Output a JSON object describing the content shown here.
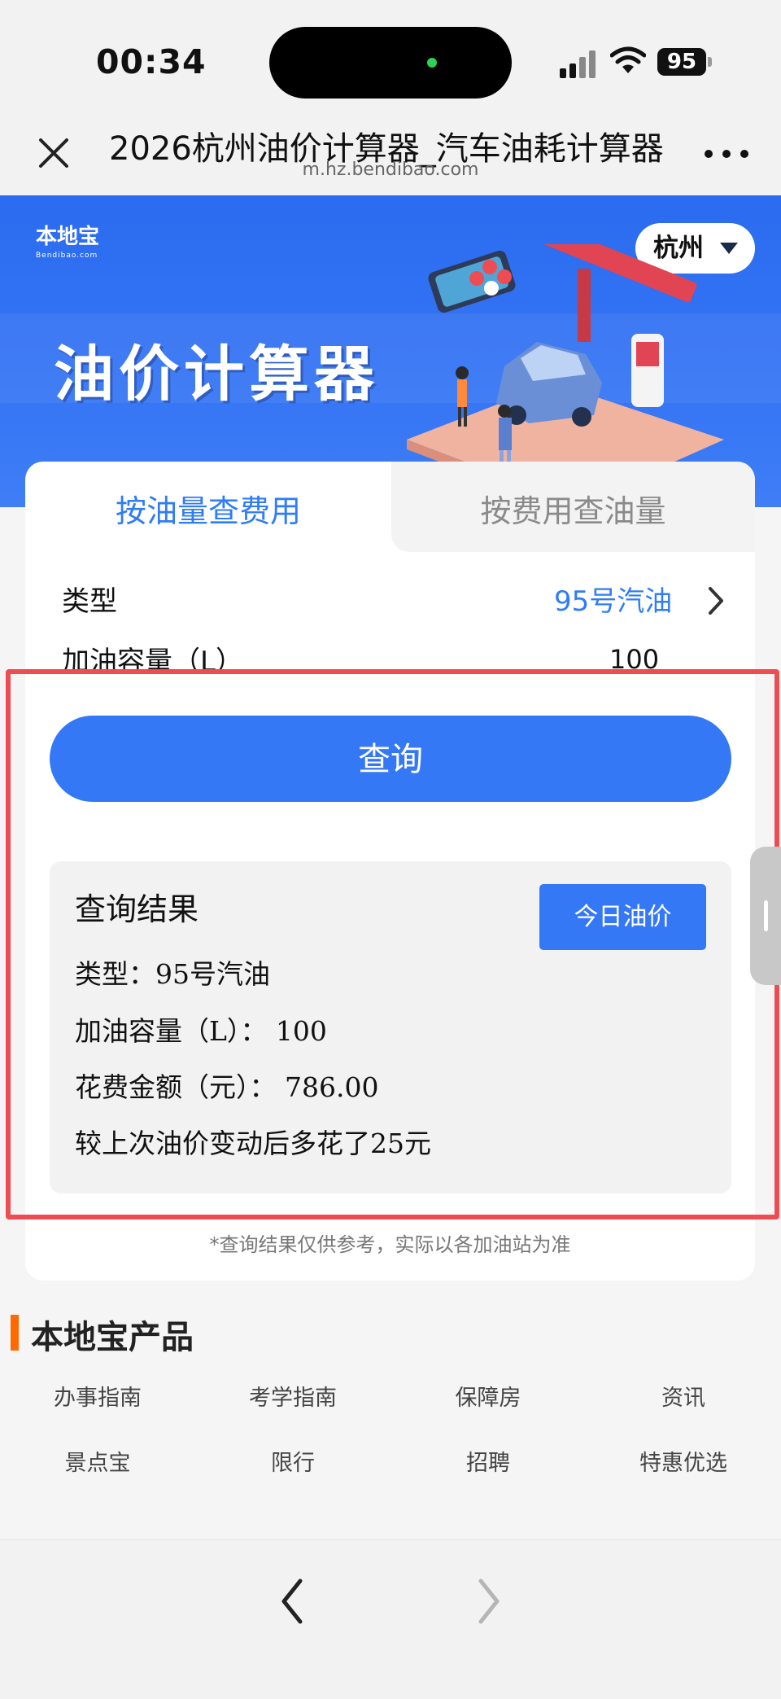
{
  "status_bar": {
    "time": "00:34",
    "battery": "95"
  },
  "browser": {
    "title": "2026杭州油价计算器_汽车油耗计算器",
    "url": "m.hz.bendibao.com",
    "icons": [
      "close-icon",
      "more-icon"
    ]
  },
  "banner": {
    "logo": "本地宝",
    "logo_sub": "Bendibao.com",
    "title": "油价计算器",
    "city": "杭州"
  },
  "tabs": [
    {
      "label": "按油量查费用",
      "active": true
    },
    {
      "label": "按费用查油量",
      "active": false
    }
  ],
  "form": {
    "type_label": "类型",
    "type_value": "95号汽油",
    "volume_label": "加油容量（L）",
    "volume_value": "100"
  },
  "query_button": "查询",
  "result": {
    "title": "查询结果",
    "today_price_button": "今日油价",
    "lines": [
      "类型：95号汽油",
      "加油容量（L）： 100",
      "花费金额（元）：  786.00",
      "较上次油价变动后多花了25元"
    ]
  },
  "disclaimer": "*查询结果仅供参考，实际以各加油站为准",
  "products": {
    "title": "本地宝产品",
    "items": [
      "办事指南",
      "考学指南",
      "保障房",
      "资讯",
      "景点宝",
      "限行",
      "招聘",
      "特惠优选"
    ]
  },
  "colors": {
    "accent": "#3478f6",
    "highlight": "#ee4c53",
    "orange": "#ff6a00"
  }
}
